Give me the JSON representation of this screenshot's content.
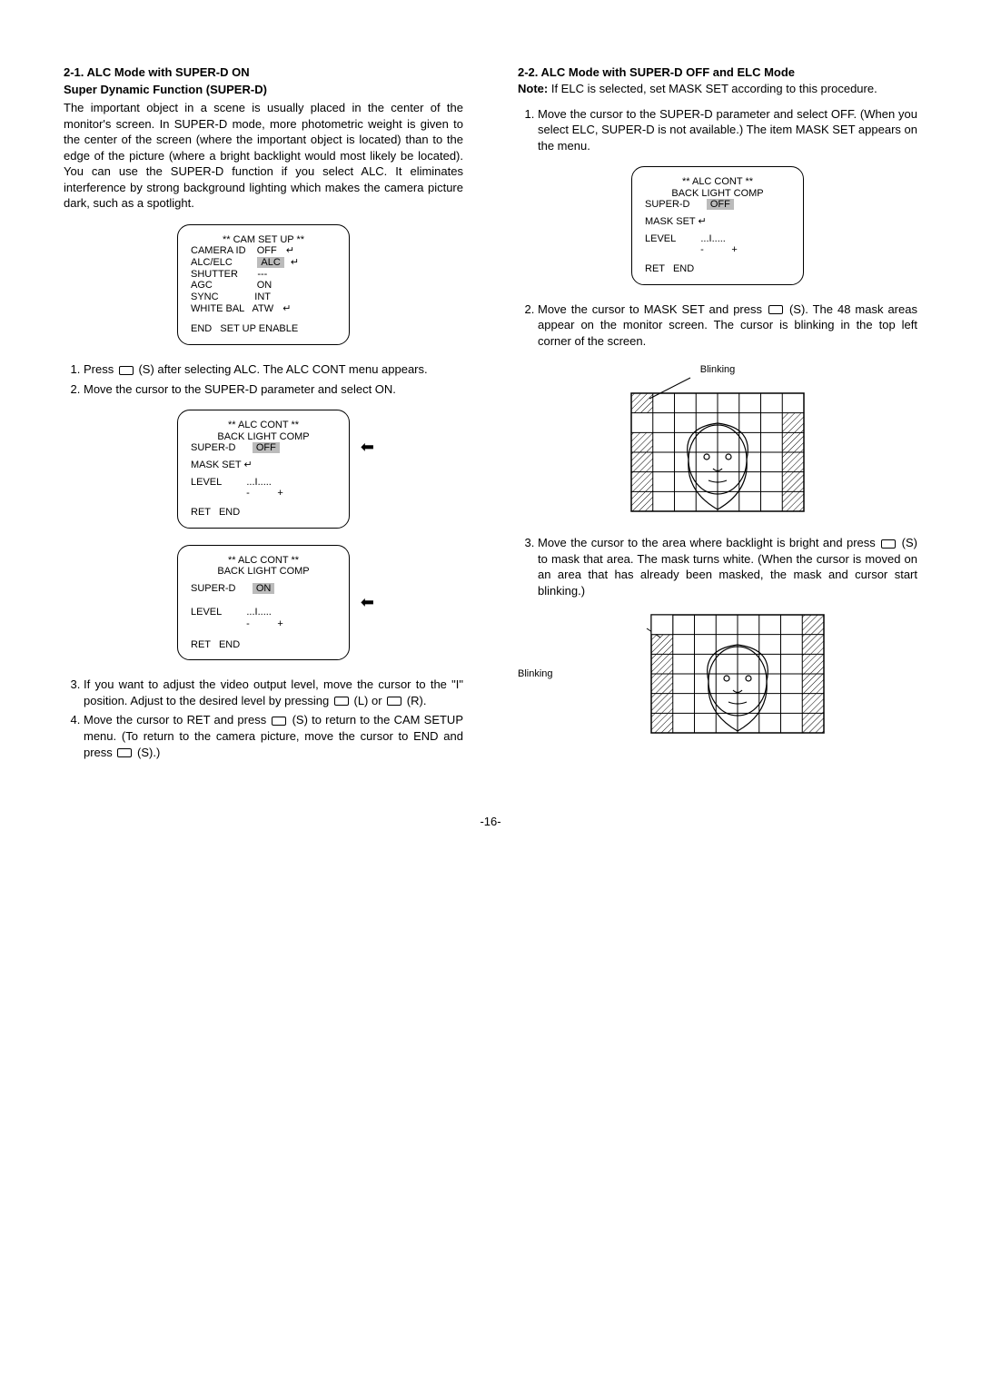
{
  "left": {
    "sec_title": "2-1. ALC Mode with SUPER-D ON",
    "subheading": "Super Dynamic Function (SUPER-D)",
    "intro": "The important object in a scene is usually placed in the center of the monitor's screen. In SUPER-D mode, more photometric weight is given to the center of the screen (where the important object is located) than to the edge of the picture (where a bright backlight would most likely be located). You can use the SUPER-D function if you select ALC. It eliminates interference by strong background lighting which makes the camera picture dark, such as a spotlight.",
    "menu1": {
      "title": "** CAM SET UP **",
      "l1a": "CAMERA ID",
      "l1b": "OFF",
      "l2a": "ALC/ELC",
      "l2b": "ALC",
      "l3a": "SHUTTER",
      "l3b": "---",
      "l4a": "AGC",
      "l4b": "ON",
      "l5a": "SYNC",
      "l5b": "INT",
      "l6a": "WHITE BAL",
      "l6b": "ATW",
      "end": "END   SET UP ENABLE"
    },
    "step1a": "Press ",
    "step1b": " (S) after selecting ALC. The ALC CONT menu appears.",
    "step2": "Move the cursor to the SUPER-D parameter and select ON.",
    "menu2": {
      "title": "** ALC CONT **",
      "sub": "BACK LIGHT COMP",
      "l1a": "SUPER-D",
      "l1b": "OFF",
      "l2a": "MASK SET ↵",
      "l3a": "LEVEL",
      "l3b": "...I.....",
      "l3c": "   -          +",
      "ret": "RET   END"
    },
    "menu3": {
      "title": "** ALC CONT **",
      "sub": "BACK LIGHT COMP",
      "l1a": "SUPER-D",
      "l1b": "ON",
      "l3a": "LEVEL",
      "l3b": "...I.....",
      "l3c": "   -          +",
      "ret": "RET   END"
    },
    "step3a": "If you want to adjust the video output level, move the cursor to the \"I\" position. Adjust to the desired level by pressing ",
    "step3b": " (L) or ",
    "step3c": " (R).",
    "step4a": "Move the cursor to RET and press ",
    "step4b": " (S) to return to the CAM SETUP menu. (To return to the camera picture, move the cursor to END and press ",
    "step4c": " (S).)"
  },
  "right": {
    "sec_title": "2-2. ALC Mode with SUPER-D OFF and ELC Mode",
    "note_label": "Note:",
    "note_text": " If ELC is selected, set MASK SET  according to this procedure.",
    "step1": "Move the cursor to the SUPER-D parameter and select OFF. (When you select ELC, SUPER-D is not available.) The item MASK SET appears on the menu.",
    "menu1": {
      "title": "** ALC CONT **",
      "sub": "BACK LIGHT COMP",
      "l1a": "SUPER-D",
      "l1b": "OFF",
      "l2a": "MASK SET ↵",
      "l3a": "LEVEL",
      "l3b": "...I.....",
      "l3c": "   -          +",
      "ret": "RET   END"
    },
    "step2a": "Move the cursor to MASK SET and press ",
    "step2b": " (S). The 48 mask areas appear on the monitor screen. The cursor is blinking in the top left corner of the screen.",
    "blink_top": "Blinking",
    "step3a": "Move the cursor to the area where backlight is bright and press ",
    "step3b": " (S) to mask that area. The mask turns white. (When the cursor is moved on an area that has already been masked, the mask and cursor start blinking.)",
    "blink_side": "Blinking"
  },
  "page": "-16-"
}
